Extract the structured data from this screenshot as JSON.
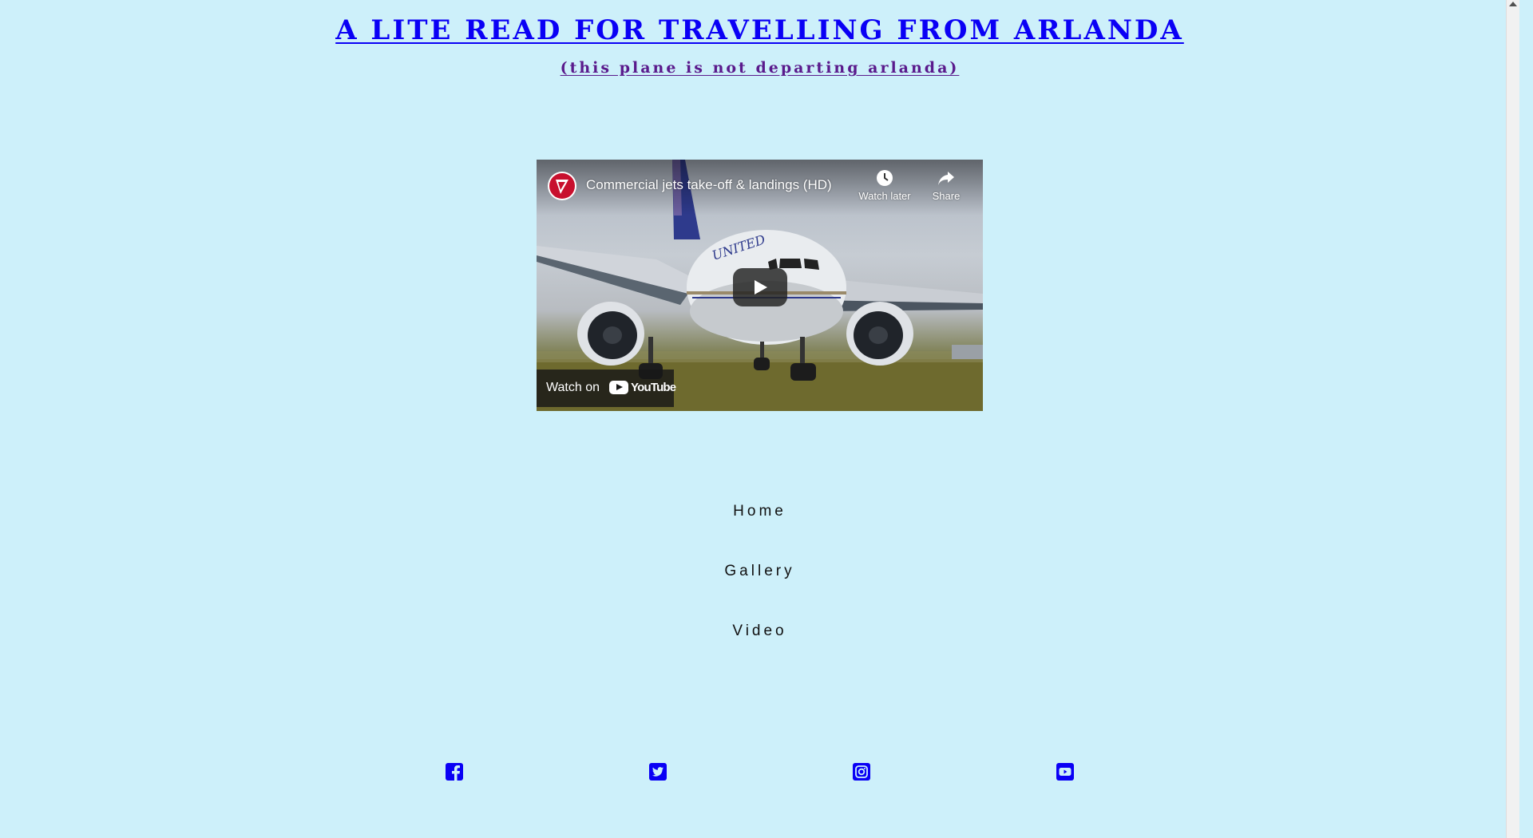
{
  "header": {
    "title": "A LITE READ FOR TRAVELLING FROM ARLANDA",
    "subtitle": "(this plane is not departing arlanda)"
  },
  "video": {
    "title": "Commercial jets take-off & landings (HD)",
    "watch_later_label": "Watch later",
    "share_label": "Share",
    "watch_on_label": "Watch on",
    "youtube_logo_text": "YouTube",
    "fuselage_text": "UNITED"
  },
  "nav": {
    "items": [
      {
        "label": "Home"
      },
      {
        "label": "Gallery"
      },
      {
        "label": "Video"
      }
    ]
  },
  "social": {
    "icons": [
      "facebook-icon",
      "twitter-icon",
      "instagram-icon",
      "youtube-icon"
    ]
  },
  "colors": {
    "background": "#cdf0fa",
    "title": "#0a00f5",
    "subtitle": "#5a1a8c",
    "social_icons": "#0a00f5"
  }
}
